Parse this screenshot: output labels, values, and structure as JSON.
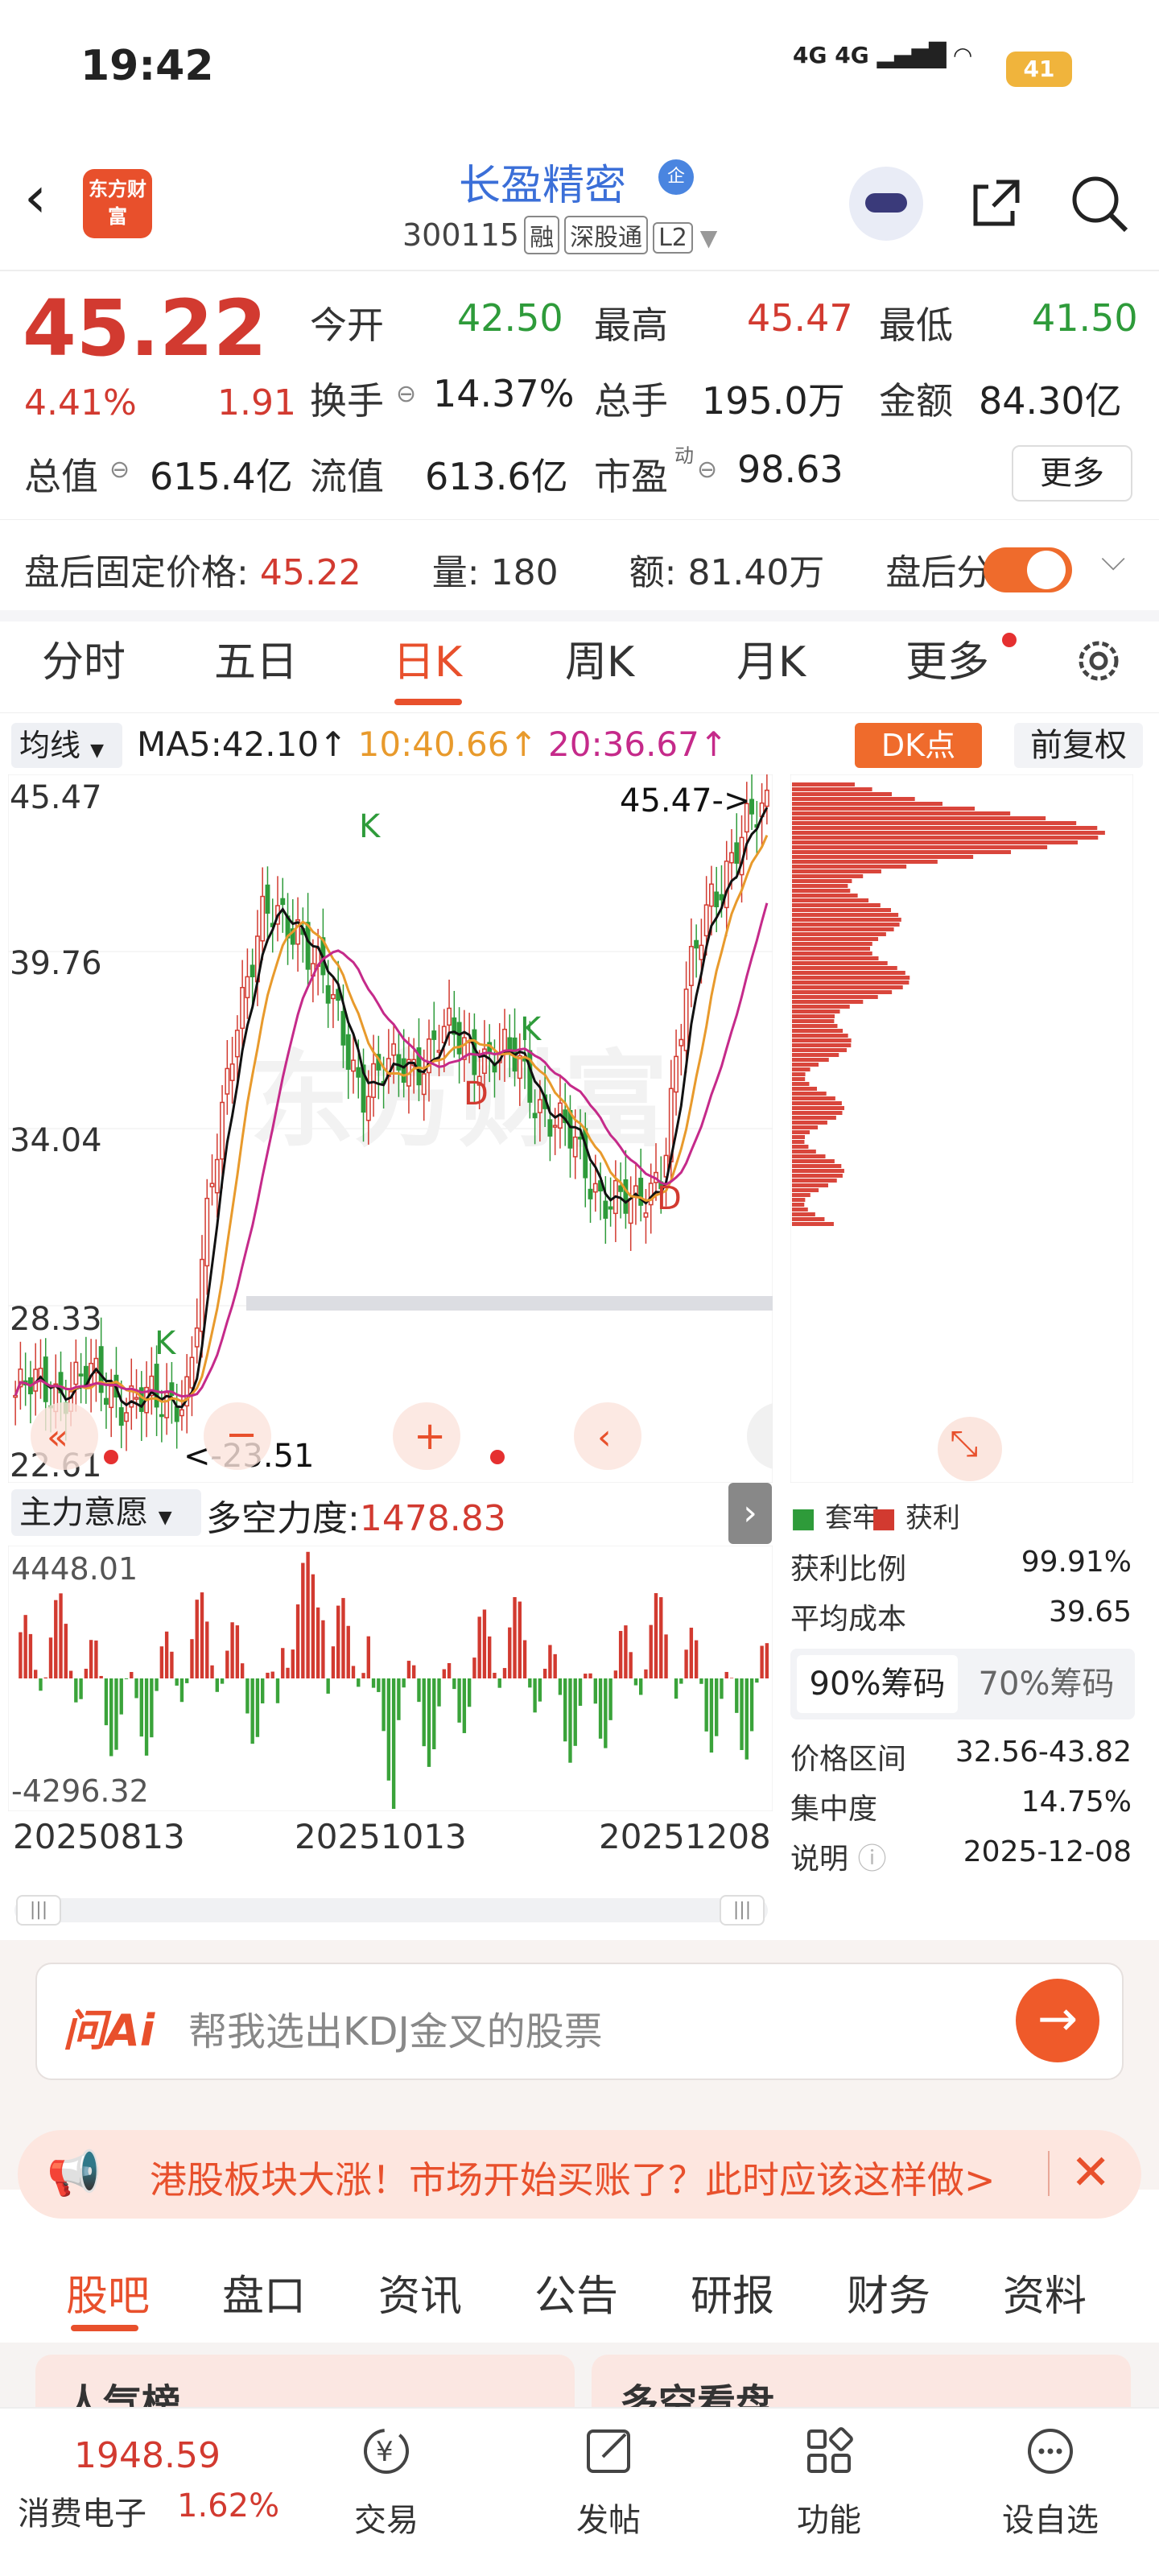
{
  "status": {
    "time": "19:42",
    "network": "4G 4G",
    "battery": "41"
  },
  "header": {
    "logo": "东方财富",
    "stock_name": "长盈精密",
    "qi_badge": "企",
    "code": "300115",
    "tags": [
      "融",
      "深股通",
      "L2"
    ]
  },
  "quote": {
    "price": "45.22",
    "pct": "4.41%",
    "change": "1.91",
    "fields": [
      {
        "label": "今开",
        "value": "42.50",
        "color": "green"
      },
      {
        "label": "最高",
        "value": "45.47",
        "color": "red"
      },
      {
        "label": "最低",
        "value": "41.50",
        "color": "green"
      },
      {
        "label": "换手",
        "value": "14.37%",
        "color": "black"
      },
      {
        "label": "总手",
        "value": "195.0万",
        "color": "black"
      },
      {
        "label": "金额",
        "value": "84.30亿",
        "color": "black"
      },
      {
        "label": "总值",
        "value": "615.4亿",
        "color": "black"
      },
      {
        "label": "流值",
        "value": "613.6亿",
        "color": "black"
      },
      {
        "label": "市盈",
        "value": "98.63",
        "color": "black"
      }
    ],
    "pe_sup": "动",
    "more": "更多"
  },
  "afterhours": {
    "label": "盘后固定价格:",
    "price": "45.22",
    "vol_label": "量:",
    "vol": "180",
    "amt_label": "额:",
    "amt": "81.40万",
    "toggle_label": "盘后分时"
  },
  "kline_tabs": [
    "分时",
    "五日",
    "日K",
    "周K",
    "月K",
    "更多"
  ],
  "chart_header": {
    "ma_selector": "均线",
    "ma5": "MA5:42.10↑",
    "ma10": "10:40.66↑",
    "ma20": "20:36.67↑",
    "dk": "DK点",
    "fq": "前复权"
  },
  "chart_data": {
    "type": "candlestick",
    "y_ticks": [
      "45.47",
      "39.76",
      "34.04",
      "28.33",
      "22.61"
    ],
    "ylim": [
      22.61,
      45.47
    ],
    "annotations": {
      "high": "45.47->",
      "low": "<-23.51",
      "k_marks": [
        "K",
        "K",
        "K"
      ],
      "d_marks": [
        "D",
        "D"
      ]
    },
    "dates": [
      "20250813",
      "20251013",
      "20251208"
    ]
  },
  "indicator": {
    "name": "主力意愿",
    "label": "多空力度:",
    "value": "1478.83",
    "max": "4448.01",
    "min": "-4296.32"
  },
  "chips": {
    "legend_hold": "套牢",
    "legend_profit": "获利",
    "rows1": [
      {
        "label": "获利比例",
        "value": "99.91%"
      },
      {
        "label": "平均成本",
        "value": "39.65"
      }
    ],
    "tab90": "90%筹码",
    "tab70": "70%筹码",
    "rows2": [
      {
        "label": "价格区间",
        "value": "32.56-43.82"
      },
      {
        "label": "集中度",
        "value": "14.75%"
      },
      {
        "label": "说明",
        "value": "2025-12-08"
      }
    ]
  },
  "ai": {
    "logo": "问Ai",
    "placeholder": "帮我选出KDJ金叉的股票"
  },
  "news": {
    "text": "港股板块大涨！市场开始买账了？此时应该这样做>"
  },
  "bottom_tabs": [
    "股吧",
    "盘口",
    "资讯",
    "公告",
    "研报",
    "财务",
    "资料"
  ],
  "cards": [
    "人气榜",
    "多空看盘"
  ],
  "bottom_nav": {
    "index_value": "1948.59",
    "index_name": "消费电子",
    "index_pct": "1.62%",
    "items": [
      "交易",
      "发帖",
      "功能",
      "设自选"
    ]
  }
}
